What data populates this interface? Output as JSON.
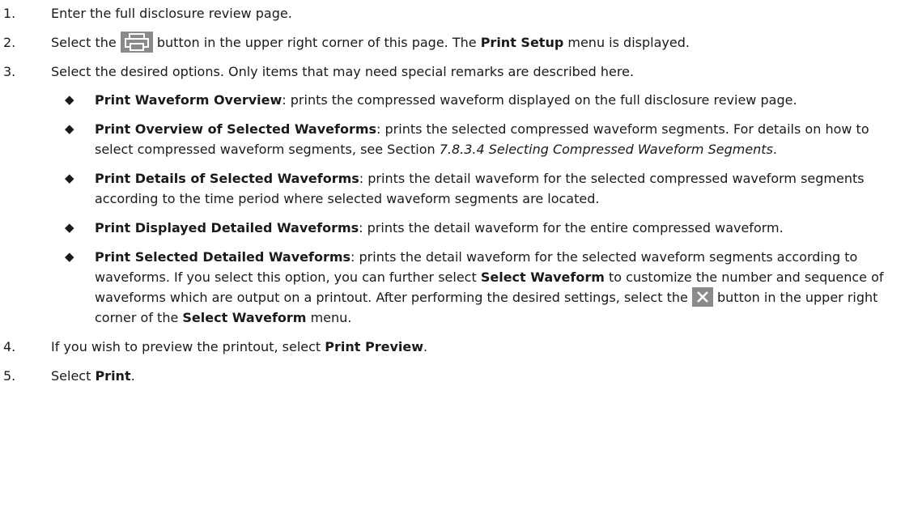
{
  "steps": [
    {
      "num": "1.",
      "text": "Enter the full disclosure review page."
    },
    {
      "num": "2.",
      "pre": "Select the",
      "post": " button in the upper right corner of this page. The ",
      "bold": "Print Setup",
      "end": " menu is displayed.",
      "icon": "printer-icon"
    },
    {
      "num": "3.",
      "text": "Select the desired options. Only items that may need special remarks are described here.",
      "bullets": [
        {
          "mark": "◆",
          "term": "Print Waveform Overview",
          "desc": ": prints the compressed waveform displayed on the full disclosure review page."
        },
        {
          "mark": "◆",
          "term": "Print Overview of Selected Waveforms",
          "desc": ": prints the selected compressed waveform segments. For details on how to select compressed waveform segments, see Section ",
          "ref": "7.8.3.4 Selecting Compressed Waveform Segments",
          "end": "."
        },
        {
          "mark": "◆",
          "term": "Print Details of Selected Waveforms",
          "desc": ": prints the detail waveform for the selected compressed waveform segments according to the time period where selected waveform segments are located."
        },
        {
          "mark": "◆",
          "term": "Print Displayed Detailed Waveforms",
          "desc": ": prints the detail waveform for the entire compressed waveform."
        },
        {
          "mark": "◆",
          "term": "Print Selected Detailed Waveforms",
          "desc": ": prints the detail waveform for the selected waveform segments according to waveforms. If you select this option, you can further select ",
          "bold2": "Select Waveform",
          "desc2": " to customize the number and sequence of waveforms which are output on a printout. After performing the desired settings, select the ",
          "desc3": " button in the upper right corner of the ",
          "bold3": "Select Waveform",
          "end": " menu.",
          "icon": "close-icon"
        }
      ]
    },
    {
      "num": "4.",
      "pre": "If you wish to preview the printout, select ",
      "bold": "Print Preview",
      "end": "."
    },
    {
      "num": "5.",
      "pre": "Select ",
      "bold": "Print",
      "end": "."
    }
  ],
  "colors": {
    "icon_bg": "#8a8a8a",
    "icon_fg": "#ffffff",
    "text": "#1a1a1a"
  }
}
